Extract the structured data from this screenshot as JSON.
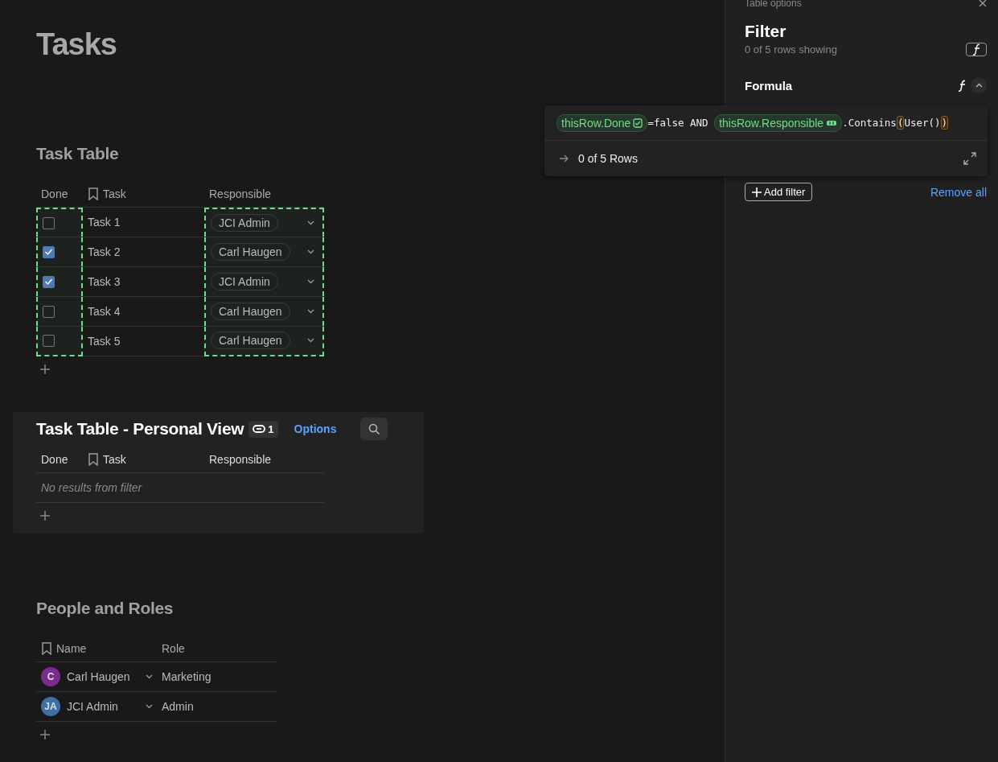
{
  "page": {
    "title": "Tasks"
  },
  "task_table": {
    "title": "Task Table",
    "columns": [
      {
        "label": "Done",
        "kind": "checkbox",
        "highlighted": true,
        "bookmark": false
      },
      {
        "label": "Task",
        "kind": "text",
        "highlighted": false,
        "bookmark": true
      },
      {
        "label": "Responsible",
        "kind": "person",
        "highlighted": true,
        "bookmark": false
      }
    ],
    "rows": [
      {
        "done": false,
        "task": "Task 1",
        "responsible": "JCI Admin"
      },
      {
        "done": true,
        "task": "Task 2",
        "responsible": "Carl Haugen"
      },
      {
        "done": true,
        "task": "Task 3",
        "responsible": "JCI Admin"
      },
      {
        "done": false,
        "task": "Task 4",
        "responsible": "Carl Haugen"
      },
      {
        "done": false,
        "task": "Task 5",
        "responsible": "Carl Haugen"
      }
    ]
  },
  "personal_view": {
    "title": "Task Table - Personal View",
    "link_count": "1",
    "options": "Options",
    "columns": [
      {
        "label": "Done",
        "bookmark": false
      },
      {
        "label": "Task",
        "bookmark": true
      },
      {
        "label": "Responsible",
        "bookmark": false
      }
    ],
    "empty_message": "No results from filter"
  },
  "people": {
    "title": "People and Roles",
    "columns": [
      {
        "label": "Name",
        "bookmark": true
      },
      {
        "label": "Role",
        "bookmark": false
      }
    ],
    "rows": [
      {
        "initials": "C",
        "color": "#7b2d8e",
        "name": "Carl Haugen",
        "role": "Marketing"
      },
      {
        "initials": "JA",
        "color": "#3d6fa3",
        "name": "JCI Admin",
        "role": "Admin"
      }
    ]
  },
  "panel": {
    "header": "Table options",
    "title": "Filter",
    "summary": "0 of 5 rows showing",
    "formula_label": "Formula",
    "add_filter": "Add filter",
    "remove_all": "Remove all"
  },
  "formula_popup": {
    "tokens": [
      {
        "kind": "checkbox_ref",
        "text": "thisRow.Done"
      },
      {
        "kind": "code",
        "text": "=false AND "
      },
      {
        "kind": "person_ref",
        "text": "thisRow.Responsible"
      },
      {
        "kind": "code",
        "text": ".Contains"
      },
      {
        "kind": "paren",
        "text": "("
      },
      {
        "kind": "code",
        "text": "User()"
      },
      {
        "kind": "paren",
        "text": ")"
      }
    ],
    "result": "0 of 5 Rows"
  }
}
